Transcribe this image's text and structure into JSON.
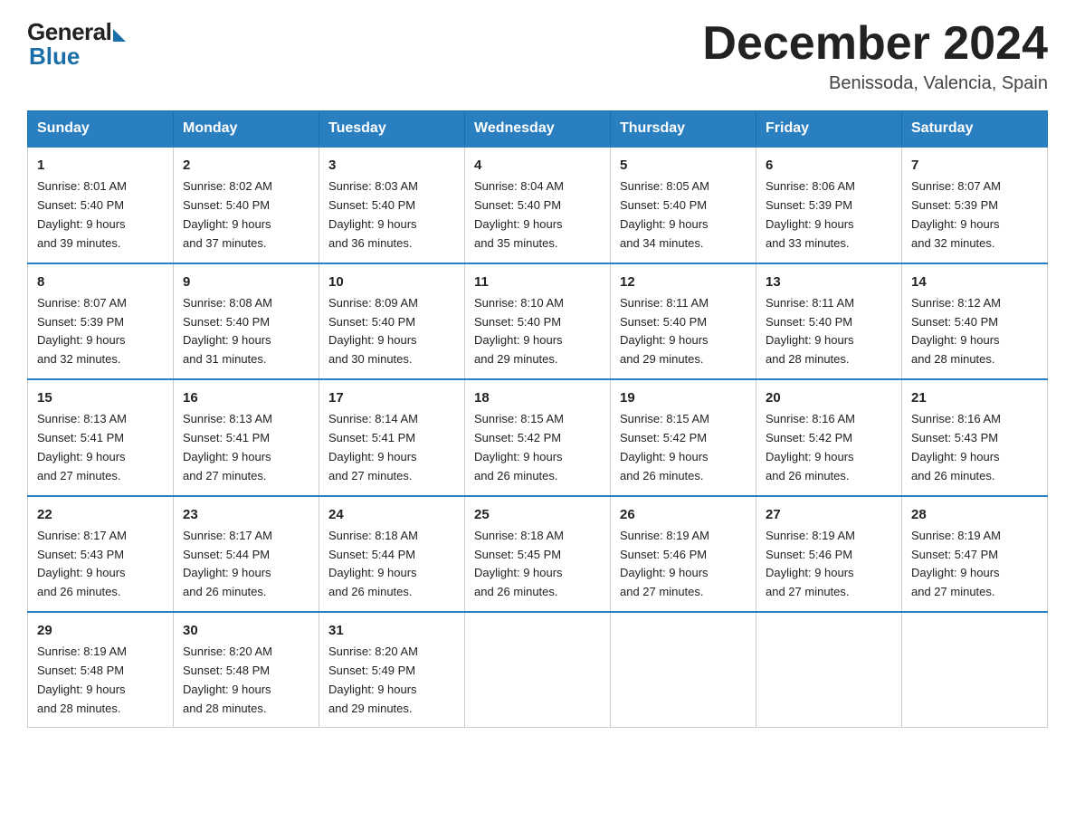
{
  "logo": {
    "general": "General",
    "blue": "Blue"
  },
  "title": "December 2024",
  "location": "Benissoda, Valencia, Spain",
  "days_of_week": [
    "Sunday",
    "Monday",
    "Tuesday",
    "Wednesday",
    "Thursday",
    "Friday",
    "Saturday"
  ],
  "weeks": [
    [
      {
        "day": "1",
        "sunrise": "8:01 AM",
        "sunset": "5:40 PM",
        "daylight": "9 hours and 39 minutes."
      },
      {
        "day": "2",
        "sunrise": "8:02 AM",
        "sunset": "5:40 PM",
        "daylight": "9 hours and 37 minutes."
      },
      {
        "day": "3",
        "sunrise": "8:03 AM",
        "sunset": "5:40 PM",
        "daylight": "9 hours and 36 minutes."
      },
      {
        "day": "4",
        "sunrise": "8:04 AM",
        "sunset": "5:40 PM",
        "daylight": "9 hours and 35 minutes."
      },
      {
        "day": "5",
        "sunrise": "8:05 AM",
        "sunset": "5:40 PM",
        "daylight": "9 hours and 34 minutes."
      },
      {
        "day": "6",
        "sunrise": "8:06 AM",
        "sunset": "5:39 PM",
        "daylight": "9 hours and 33 minutes."
      },
      {
        "day": "7",
        "sunrise": "8:07 AM",
        "sunset": "5:39 PM",
        "daylight": "9 hours and 32 minutes."
      }
    ],
    [
      {
        "day": "8",
        "sunrise": "8:07 AM",
        "sunset": "5:39 PM",
        "daylight": "9 hours and 32 minutes."
      },
      {
        "day": "9",
        "sunrise": "8:08 AM",
        "sunset": "5:40 PM",
        "daylight": "9 hours and 31 minutes."
      },
      {
        "day": "10",
        "sunrise": "8:09 AM",
        "sunset": "5:40 PM",
        "daylight": "9 hours and 30 minutes."
      },
      {
        "day": "11",
        "sunrise": "8:10 AM",
        "sunset": "5:40 PM",
        "daylight": "9 hours and 29 minutes."
      },
      {
        "day": "12",
        "sunrise": "8:11 AM",
        "sunset": "5:40 PM",
        "daylight": "9 hours and 29 minutes."
      },
      {
        "day": "13",
        "sunrise": "8:11 AM",
        "sunset": "5:40 PM",
        "daylight": "9 hours and 28 minutes."
      },
      {
        "day": "14",
        "sunrise": "8:12 AM",
        "sunset": "5:40 PM",
        "daylight": "9 hours and 28 minutes."
      }
    ],
    [
      {
        "day": "15",
        "sunrise": "8:13 AM",
        "sunset": "5:41 PM",
        "daylight": "9 hours and 27 minutes."
      },
      {
        "day": "16",
        "sunrise": "8:13 AM",
        "sunset": "5:41 PM",
        "daylight": "9 hours and 27 minutes."
      },
      {
        "day": "17",
        "sunrise": "8:14 AM",
        "sunset": "5:41 PM",
        "daylight": "9 hours and 27 minutes."
      },
      {
        "day": "18",
        "sunrise": "8:15 AM",
        "sunset": "5:42 PM",
        "daylight": "9 hours and 26 minutes."
      },
      {
        "day": "19",
        "sunrise": "8:15 AM",
        "sunset": "5:42 PM",
        "daylight": "9 hours and 26 minutes."
      },
      {
        "day": "20",
        "sunrise": "8:16 AM",
        "sunset": "5:42 PM",
        "daylight": "9 hours and 26 minutes."
      },
      {
        "day": "21",
        "sunrise": "8:16 AM",
        "sunset": "5:43 PM",
        "daylight": "9 hours and 26 minutes."
      }
    ],
    [
      {
        "day": "22",
        "sunrise": "8:17 AM",
        "sunset": "5:43 PM",
        "daylight": "9 hours and 26 minutes."
      },
      {
        "day": "23",
        "sunrise": "8:17 AM",
        "sunset": "5:44 PM",
        "daylight": "9 hours and 26 minutes."
      },
      {
        "day": "24",
        "sunrise": "8:18 AM",
        "sunset": "5:44 PM",
        "daylight": "9 hours and 26 minutes."
      },
      {
        "day": "25",
        "sunrise": "8:18 AM",
        "sunset": "5:45 PM",
        "daylight": "9 hours and 26 minutes."
      },
      {
        "day": "26",
        "sunrise": "8:19 AM",
        "sunset": "5:46 PM",
        "daylight": "9 hours and 27 minutes."
      },
      {
        "day": "27",
        "sunrise": "8:19 AM",
        "sunset": "5:46 PM",
        "daylight": "9 hours and 27 minutes."
      },
      {
        "day": "28",
        "sunrise": "8:19 AM",
        "sunset": "5:47 PM",
        "daylight": "9 hours and 27 minutes."
      }
    ],
    [
      {
        "day": "29",
        "sunrise": "8:19 AM",
        "sunset": "5:48 PM",
        "daylight": "9 hours and 28 minutes."
      },
      {
        "day": "30",
        "sunrise": "8:20 AM",
        "sunset": "5:48 PM",
        "daylight": "9 hours and 28 minutes."
      },
      {
        "day": "31",
        "sunrise": "8:20 AM",
        "sunset": "5:49 PM",
        "daylight": "9 hours and 29 minutes."
      },
      null,
      null,
      null,
      null
    ]
  ],
  "labels": {
    "sunrise": "Sunrise:",
    "sunset": "Sunset:",
    "daylight": "Daylight:"
  }
}
